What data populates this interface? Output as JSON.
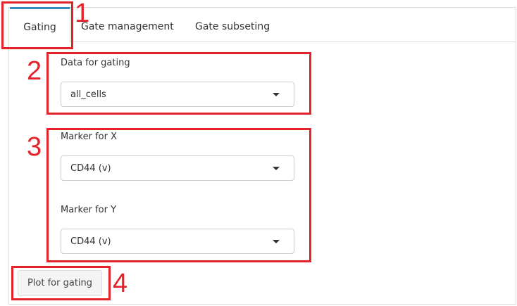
{
  "tabs": [
    {
      "label": "Gating",
      "active": true
    },
    {
      "label": "Gate management",
      "active": false
    },
    {
      "label": "Gate subseting",
      "active": false
    }
  ],
  "data_select": {
    "label": "Data for gating",
    "value": "all_cells"
  },
  "marker_x": {
    "label": "Marker for X",
    "value": "CD44 (v)"
  },
  "marker_y": {
    "label": "Marker for Y",
    "value": "CD44 (v)"
  },
  "plot_button": {
    "label": "Plot for gating"
  },
  "annotations": [
    "1",
    "2",
    "3",
    "4"
  ],
  "colors": {
    "annotation": "#e5212a",
    "active_tab": "#3c8dbc"
  }
}
